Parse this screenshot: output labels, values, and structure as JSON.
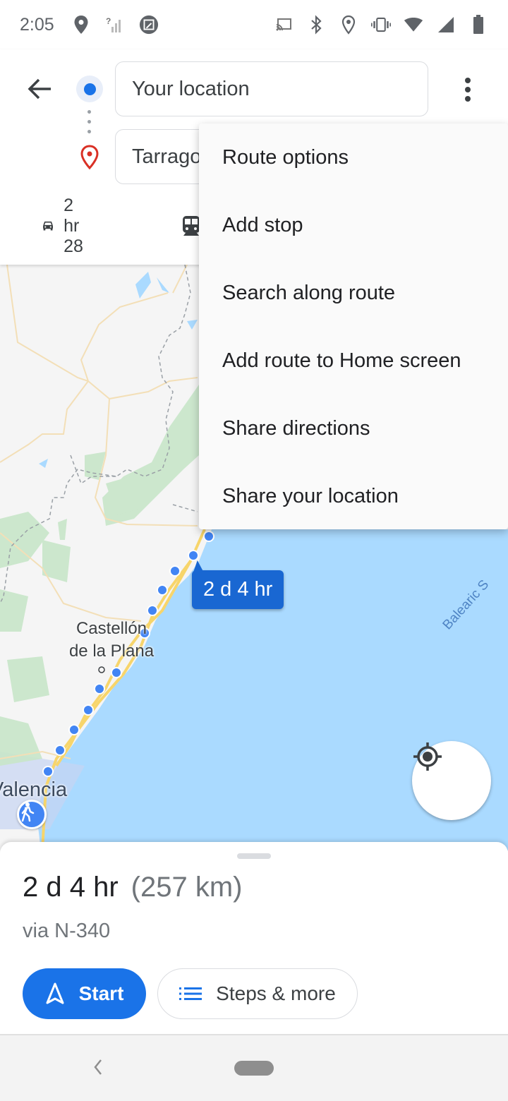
{
  "status_bar": {
    "time": "2:05",
    "left_icons": [
      "location-pin-icon",
      "no-signal-icon",
      "screenshot-edit-icon"
    ],
    "right_icons": [
      "cast-icon",
      "bluetooth-icon",
      "location-outline-icon",
      "vibrate-icon",
      "wifi-icon",
      "cell-signal-icon",
      "battery-icon"
    ]
  },
  "header": {
    "origin": "Your location",
    "destination": "Tarragona",
    "destination_visible": "Tarrago",
    "modes": [
      {
        "icon": "car-icon",
        "label": "2 hr 28"
      },
      {
        "icon": "train-icon",
        "label": ""
      }
    ]
  },
  "menu": {
    "items": [
      {
        "label": "Route options"
      },
      {
        "label": "Add stop"
      },
      {
        "label": "Search along route"
      },
      {
        "label": "Add route to Home screen"
      },
      {
        "label": "Share directions"
      },
      {
        "label": "Share your location"
      }
    ]
  },
  "map": {
    "callout": "2 d 4 hr",
    "cities": {
      "castellon": "Castellón\nde la Plana",
      "valencia": "Valencia"
    },
    "sea_label": "Balearic Sea",
    "sea_label_visible": "Balearic S",
    "colors": {
      "land": "#f5f5f5",
      "sea": "#aadaff",
      "route_dots": "#4285f4",
      "road": "#f7d56b",
      "park": "#c8e6c9"
    }
  },
  "sheet": {
    "duration": "2 d 4 hr",
    "distance": "(257 km)",
    "via": "via N-340",
    "start_label": "Start",
    "steps_label": "Steps & more"
  },
  "colors": {
    "accent": "#1a73e8",
    "callout": "#1967d2"
  }
}
